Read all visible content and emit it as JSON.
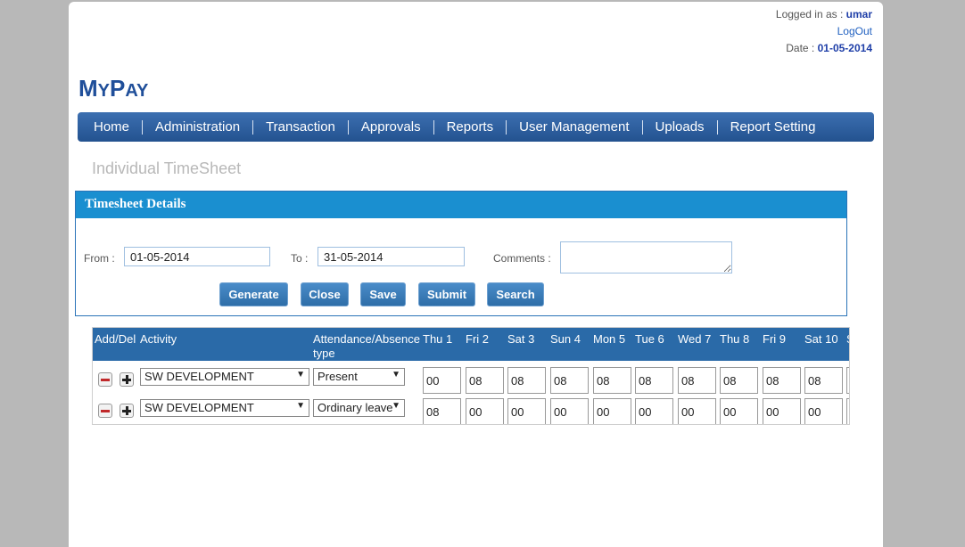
{
  "header": {
    "logged_in_label": "Logged in as :",
    "user": "umar",
    "logout": "LogOut",
    "date_label": "Date :",
    "date": "01-05-2014"
  },
  "logo": {
    "first_big": "M",
    "first_small": "Y",
    "second_big": "P",
    "second_small": "AY"
  },
  "nav": [
    "Home",
    "Administration",
    "Transaction",
    "Approvals",
    "Reports",
    "User Management",
    "Uploads",
    "Report Setting"
  ],
  "page_title": "Individual TimeSheet",
  "panel": {
    "title": "Timesheet Details",
    "from_label": "From :",
    "from_value": "01-05-2014",
    "to_label": "To :",
    "to_value": "31-05-2014",
    "comments_label": "Comments :",
    "comments_value": "",
    "buttons": [
      "Generate",
      "Close",
      "Save",
      "Submit",
      "Search"
    ]
  },
  "grid": {
    "headers": {
      "add_del": "Add/Del",
      "activity": "Activity",
      "attendance_line1": "Attendance/Absence",
      "attendance_line2": "type",
      "days": [
        "Thu 1",
        "Fri 2",
        "Sat 3",
        "Sun 4",
        "Mon 5",
        "Tue 6",
        "Wed 7",
        "Thu 8",
        "Fri 9",
        "Sat 10",
        "S"
      ]
    },
    "rows": [
      {
        "activity": "SW DEVELOPMENT",
        "attendance": "Present",
        "hours": [
          "00",
          "08",
          "08",
          "08",
          "08",
          "08",
          "08",
          "08",
          "08",
          "08"
        ]
      },
      {
        "activity": "SW DEVELOPMENT",
        "attendance": "Ordinary leave",
        "hours": [
          "08",
          "00",
          "00",
          "00",
          "00",
          "00",
          "00",
          "00",
          "00",
          "00"
        ]
      }
    ]
  }
}
